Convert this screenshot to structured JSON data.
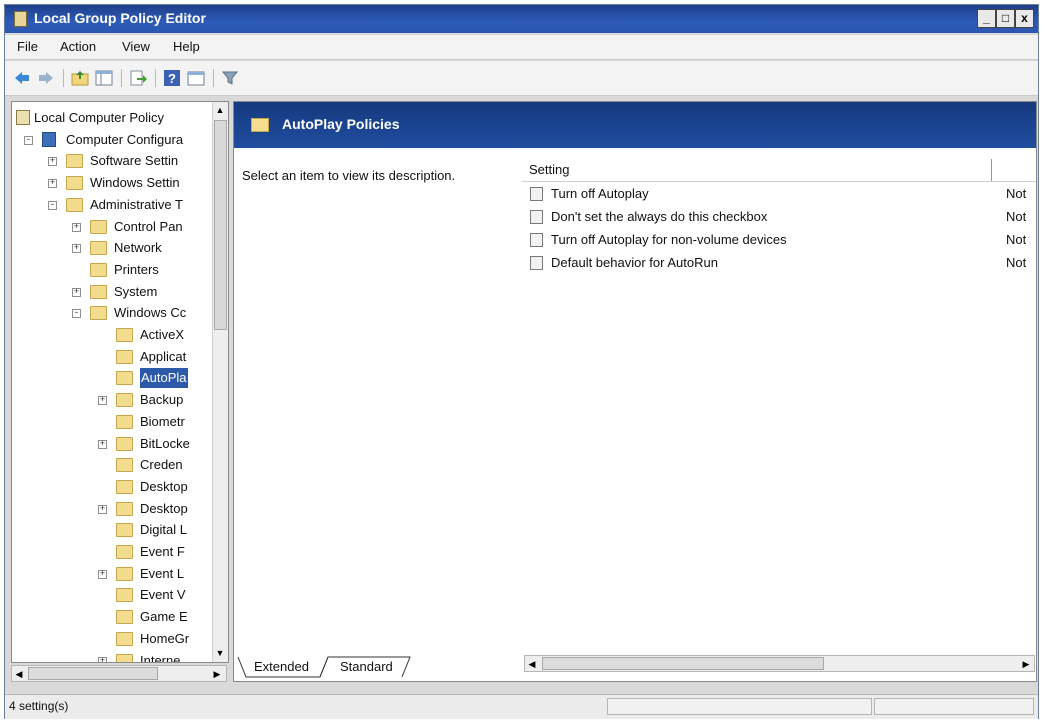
{
  "window": {
    "title": "Local Group Policy Editor",
    "buttons": [
      "_",
      "□",
      "x"
    ]
  },
  "menubar": [
    "File",
    "Action",
    "View",
    "Help"
  ],
  "toolbar_icons": [
    "back-icon",
    "forward-icon",
    "up-folder-icon",
    "show-hide-tree-icon",
    "export-list-icon",
    "help-icon",
    "properties-icon",
    "filter-icon"
  ],
  "tree": {
    "items": [
      {
        "label": "Local Computer Policy",
        "level": 0,
        "expander": "none",
        "icon": "policy-icon"
      },
      {
        "label": "Computer Configura",
        "level": 1,
        "expander": "-",
        "icon": "computer-icon"
      },
      {
        "label": "Software Settin",
        "level": 2,
        "expander": "+",
        "icon": "folder-icon"
      },
      {
        "label": "Windows Settin",
        "level": 2,
        "expander": "+",
        "icon": "folder-icon"
      },
      {
        "label": "Administrative T",
        "level": 2,
        "expander": "-",
        "icon": "folder-icon"
      },
      {
        "label": "Control Pan",
        "level": 3,
        "expander": "+",
        "icon": "folder-icon"
      },
      {
        "label": "Network",
        "level": 3,
        "expander": "+",
        "icon": "folder-icon"
      },
      {
        "label": "Printers",
        "level": 3,
        "expander": "none",
        "icon": "folder-icon"
      },
      {
        "label": "System",
        "level": 3,
        "expander": "+",
        "icon": "folder-icon"
      },
      {
        "label": "Windows Cc",
        "level": 3,
        "expander": "-",
        "icon": "folder-icon"
      },
      {
        "label": "ActiveX",
        "level": 4,
        "expander": "none",
        "icon": "folder-icon"
      },
      {
        "label": "Applicat",
        "level": 4,
        "expander": "none",
        "icon": "folder-icon"
      },
      {
        "label": "AutoPla",
        "level": 4,
        "expander": "none",
        "icon": "folder-icon",
        "selected": true
      },
      {
        "label": "Backup",
        "level": 4,
        "expander": "+",
        "icon": "folder-icon"
      },
      {
        "label": "Biometr",
        "level": 4,
        "expander": "none",
        "icon": "folder-icon"
      },
      {
        "label": "BitLocke",
        "level": 4,
        "expander": "+",
        "icon": "folder-icon"
      },
      {
        "label": "Creden",
        "level": 4,
        "expander": "none",
        "icon": "folder-icon"
      },
      {
        "label": "Desktop",
        "level": 4,
        "expander": "none",
        "icon": "folder-icon"
      },
      {
        "label": "Desktop",
        "level": 4,
        "expander": "+",
        "icon": "folder-icon"
      },
      {
        "label": "Digital L",
        "level": 4,
        "expander": "none",
        "icon": "folder-icon"
      },
      {
        "label": "Event F",
        "level": 4,
        "expander": "none",
        "icon": "folder-icon"
      },
      {
        "label": "Event L",
        "level": 4,
        "expander": "+",
        "icon": "folder-icon"
      },
      {
        "label": "Event V",
        "level": 4,
        "expander": "none",
        "icon": "folder-icon"
      },
      {
        "label": "Game E",
        "level": 4,
        "expander": "none",
        "icon": "folder-icon"
      },
      {
        "label": "HomeGr",
        "level": 4,
        "expander": "none",
        "icon": "folder-icon"
      },
      {
        "label": "Interne",
        "level": 4,
        "expander": "+",
        "icon": "folder-icon"
      }
    ]
  },
  "right": {
    "header_title": "AutoPlay Policies",
    "description": "Select an item to view its description.",
    "column_setting": "Setting",
    "rows": [
      {
        "name": "Turn off Autoplay",
        "state": "Not c"
      },
      {
        "name": "Don't set the always do this checkbox",
        "state": "Not c"
      },
      {
        "name": "Turn off Autoplay for non-volume devices",
        "state": "Not c"
      },
      {
        "name": "Default behavior for AutoRun",
        "state": "Not c"
      }
    ],
    "tabs": [
      "Extended",
      "Standard"
    ]
  },
  "status": {
    "text": "4 setting(s)"
  }
}
